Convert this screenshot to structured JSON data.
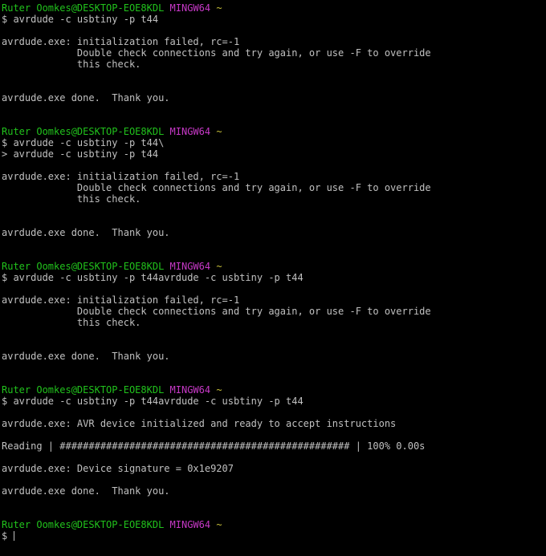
{
  "colors": {
    "background": "#000000",
    "text": "#c0c0c0",
    "prompt_user": "#21c21c",
    "prompt_shell": "#c739c7",
    "prompt_path": "#c8c03a"
  },
  "prompt": {
    "user_host": "Ruter Oomkes@DESKTOP-EOE8KDL",
    "shell": "MINGW64",
    "path": "~"
  },
  "lines": [
    {
      "type": "prompt"
    },
    {
      "type": "text",
      "text": "$ avrdude -c usbtiny -p t44"
    },
    {
      "type": "text",
      "text": ""
    },
    {
      "type": "text",
      "text": "avrdude.exe: initialization failed, rc=-1"
    },
    {
      "type": "text",
      "text": "             Double check connections and try again, or use -F to override"
    },
    {
      "type": "text",
      "text": "             this check."
    },
    {
      "type": "text",
      "text": ""
    },
    {
      "type": "text",
      "text": ""
    },
    {
      "type": "text",
      "text": "avrdude.exe done.  Thank you."
    },
    {
      "type": "text",
      "text": ""
    },
    {
      "type": "text",
      "text": ""
    },
    {
      "type": "prompt"
    },
    {
      "type": "text",
      "text": "$ avrdude -c usbtiny -p t44\\"
    },
    {
      "type": "text",
      "text": "> avrdude -c usbtiny -p t44"
    },
    {
      "type": "text",
      "text": ""
    },
    {
      "type": "text",
      "text": "avrdude.exe: initialization failed, rc=-1"
    },
    {
      "type": "text",
      "text": "             Double check connections and try again, or use -F to override"
    },
    {
      "type": "text",
      "text": "             this check."
    },
    {
      "type": "text",
      "text": ""
    },
    {
      "type": "text",
      "text": ""
    },
    {
      "type": "text",
      "text": "avrdude.exe done.  Thank you."
    },
    {
      "type": "text",
      "text": ""
    },
    {
      "type": "text",
      "text": ""
    },
    {
      "type": "prompt"
    },
    {
      "type": "text",
      "text": "$ avrdude -c usbtiny -p t44avrdude -c usbtiny -p t44"
    },
    {
      "type": "text",
      "text": ""
    },
    {
      "type": "text",
      "text": "avrdude.exe: initialization failed, rc=-1"
    },
    {
      "type": "text",
      "text": "             Double check connections and try again, or use -F to override"
    },
    {
      "type": "text",
      "text": "             this check."
    },
    {
      "type": "text",
      "text": ""
    },
    {
      "type": "text",
      "text": ""
    },
    {
      "type": "text",
      "text": "avrdude.exe done.  Thank you."
    },
    {
      "type": "text",
      "text": ""
    },
    {
      "type": "text",
      "text": ""
    },
    {
      "type": "prompt"
    },
    {
      "type": "text",
      "text": "$ avrdude -c usbtiny -p t44avrdude -c usbtiny -p t44"
    },
    {
      "type": "text",
      "text": ""
    },
    {
      "type": "text",
      "text": "avrdude.exe: AVR device initialized and ready to accept instructions"
    },
    {
      "type": "text",
      "text": ""
    },
    {
      "type": "text",
      "text": "Reading | ################################################## | 100% 0.00s"
    },
    {
      "type": "text",
      "text": ""
    },
    {
      "type": "text",
      "text": "avrdude.exe: Device signature = 0x1e9207"
    },
    {
      "type": "text",
      "text": ""
    },
    {
      "type": "text",
      "text": "avrdude.exe done.  Thank you."
    },
    {
      "type": "text",
      "text": ""
    },
    {
      "type": "text",
      "text": ""
    },
    {
      "type": "prompt"
    },
    {
      "type": "input",
      "text": "$ "
    }
  ]
}
